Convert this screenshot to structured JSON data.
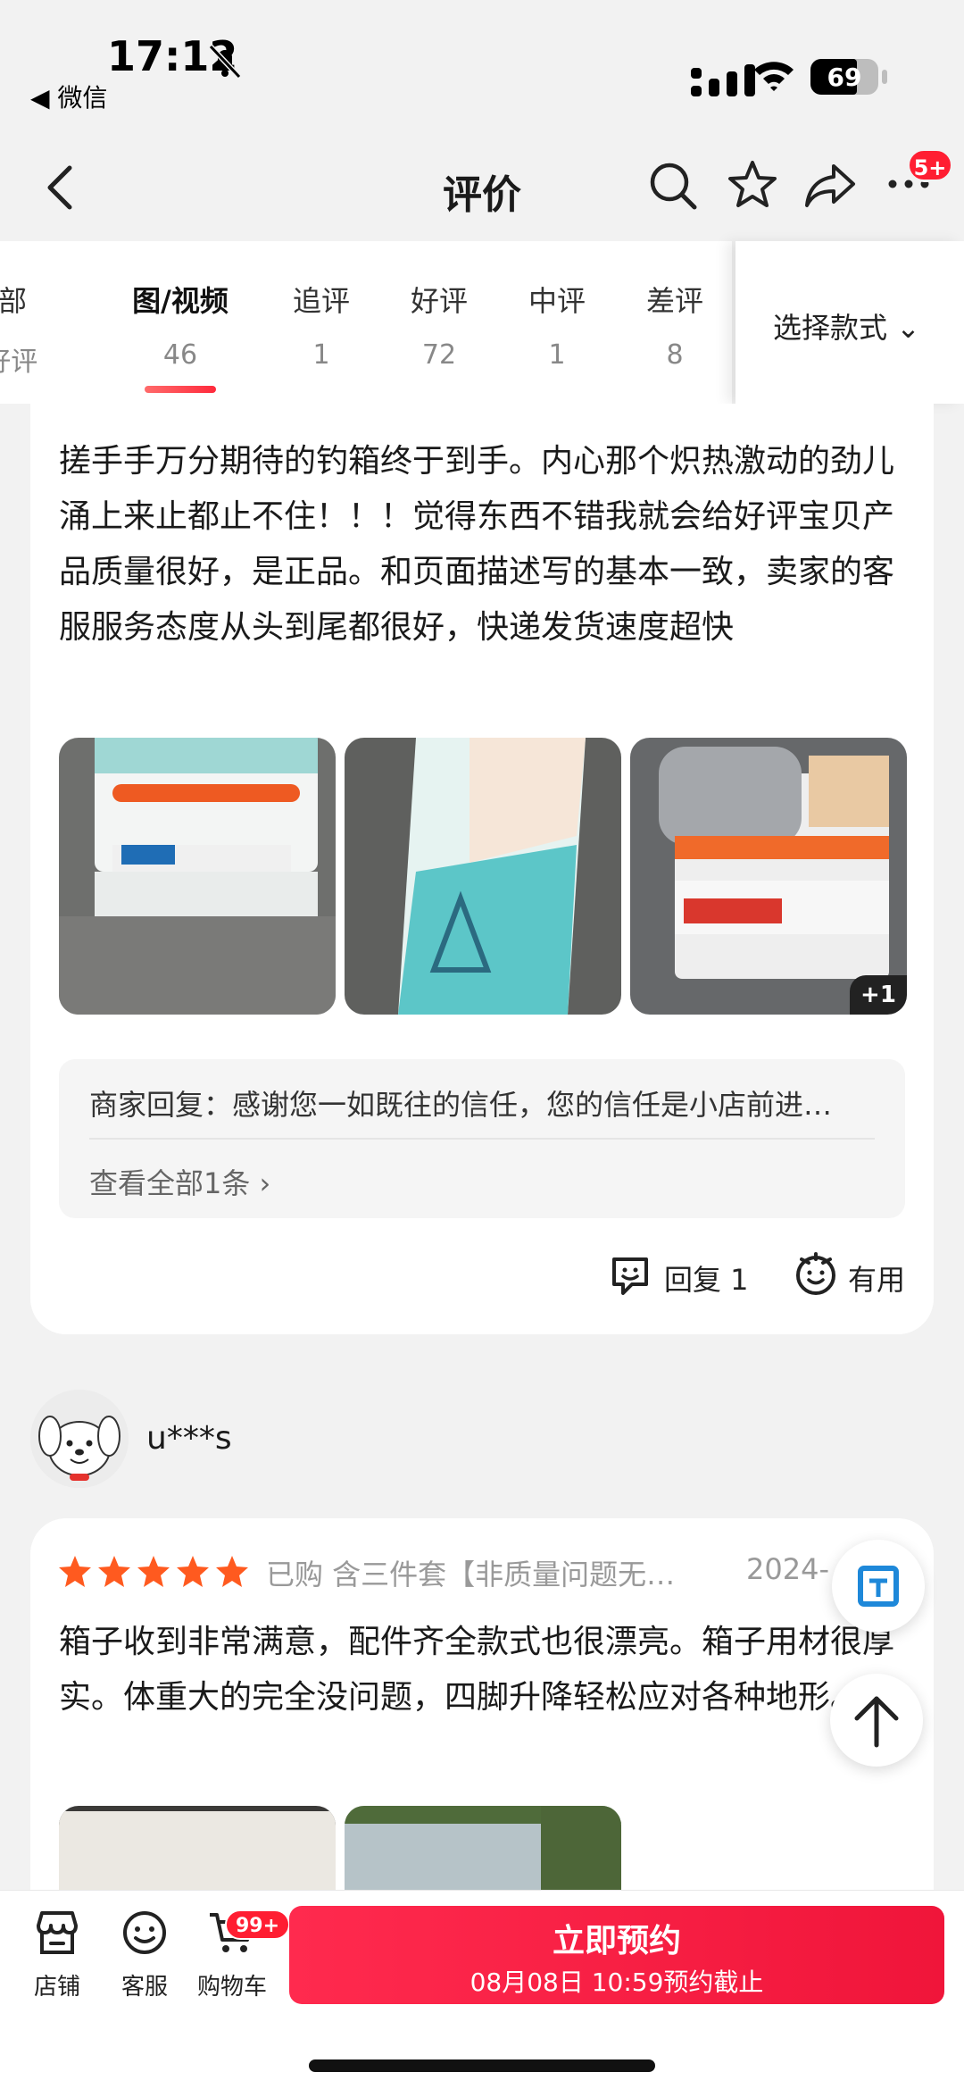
{
  "status_bar": {
    "time": "17:12",
    "back_app": "◀ 微信",
    "battery": "69"
  },
  "nav": {
    "title": "评价",
    "more_badge": "5+"
  },
  "filter_tabs": [
    {
      "label": "全部",
      "count": "%好评"
    },
    {
      "label": "图/视频",
      "count": "46"
    },
    {
      "label": "追评",
      "count": "1"
    },
    {
      "label": "好评",
      "count": "72"
    },
    {
      "label": "中评",
      "count": "1"
    },
    {
      "label": "差评",
      "count": "8"
    }
  ],
  "style_select": {
    "label": "选择款式 ⌄"
  },
  "review1": {
    "text": "搓手手万分期待的钓箱终于到手。内心那个炽热激动的劲儿涌上来止都止不住！！！觉得东西不错我就会给好评宝贝产品质量很好，是正品。和页面描述写的基本一致，卖家的客服服务态度从头到尾都很好，快递发货速度超快",
    "more_images": "+1",
    "merchant_reply": "商家回复：感谢您一如既往的信任，您的信任是小店前进…",
    "view_all": "查看全部1条 ›",
    "reply_label": "回复 1",
    "useful_label": "有用"
  },
  "review2": {
    "username": "u***s",
    "rating": 5,
    "meta": "已购 含三件套【非质量问题无…",
    "date": "2024-",
    "text": "箱子收到非常满意，配件齐全款式也很漂亮。箱子用材很厚实。体重大的完全没问题，四脚升降轻松应对各种地形。"
  },
  "bottom_bar": {
    "store": "店铺",
    "service": "客服",
    "cart": "购物车",
    "cart_badge": "99+",
    "cta_title": "立即预约",
    "cta_sub": "08月08日 10:59预约截止"
  },
  "colors": {
    "accent": "#ff2a4e",
    "star": "#ff5a1f",
    "badge": "#ff1e32"
  }
}
